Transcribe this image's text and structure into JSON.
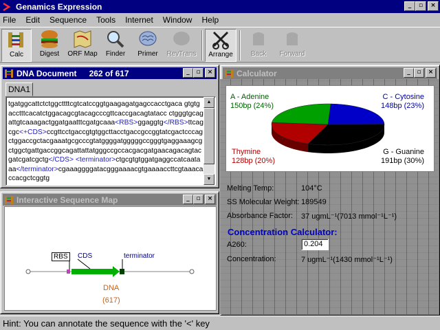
{
  "app": {
    "title": "Genamics Expression",
    "controls": {
      "minimize": "_",
      "maximize": "▫",
      "close": "×"
    }
  },
  "menu": [
    "File",
    "Edit",
    "Sequence",
    "Tools",
    "Internet",
    "Window",
    "Help"
  ],
  "toolbar": {
    "calc": "Calc",
    "digest": "Digest",
    "orf_map": "ORF Map",
    "finder": "Finder",
    "primer": "Primer",
    "revtrans": "RevTrans",
    "arrange": "Arrange",
    "back": "Back",
    "forward": "Forward"
  },
  "dna_window": {
    "title": "DNA Document",
    "position": "262 of 617",
    "tab": "DNA1",
    "sequence_segments": [
      {
        "text": "tgatggcattctctggcttttcgtcatccggtgaagagatgagccacctgaca gtgtgacctttcacatctggacagcgtacagcccgttcaccgacagtatacc ctgggtgcagattgtcaaagactggatgaatttcgatgcaaa",
        "tag": false
      },
      {
        "text": "<RBS>",
        "tag": true
      },
      {
        "text": "ggaggtg",
        "tag": false
      },
      {
        "text": "</RBS>",
        "tag": true
      },
      {
        "text": "ttcagcgc",
        "tag": false
      },
      {
        "text": "<+CDS>",
        "tag": true
      },
      {
        "text": "ccgttcctgaccgtgtggcttacctgaccgccggtatcgactcccagctggaccgctacgaaatgcgcccgtatggggatgggggccgggtgaggaaagcgctggctgattgaccggcagattattatgggccgccacgacgatgaacagacagtacgatcgatcgctg",
        "tag": false
      },
      {
        "text": "</CDS>",
        "tag": true
      },
      {
        "text": " ",
        "tag": false
      },
      {
        "text": "<terminator>",
        "tag": true
      },
      {
        "text": "ctgcgtgtggatgaggccatcaataaa",
        "tag": false
      },
      {
        "text": "</terminator>",
        "tag": true
      },
      {
        "text": "cgaaaggggatacgggaaaacgtgaaaaccttcgtaaacaccacgctcggtg",
        "tag": false
      }
    ]
  },
  "map_window": {
    "title": "Interactive Sequence Map",
    "features": {
      "rbs": "RBS",
      "cds": "CDS",
      "terminator": "terminator"
    },
    "name": "DNA",
    "length": "(617)"
  },
  "calc_window": {
    "title": "Calculator",
    "pie_labels": {
      "adenine": "A - Adenine",
      "adenine_val": "150bp (24%)",
      "cytosine": "C - Cytosine",
      "cytosine_val": "148bp (23%)",
      "thymine": "Thymine",
      "thymine_val": "128bp (20%)",
      "guanine": "G - Guanine",
      "guanine_val": "191bp (30%)"
    },
    "pie_colors": {
      "adenine": "#00a000",
      "cytosine": "#0000c8",
      "thymine": "#b00000",
      "guanine": "#000000"
    },
    "properties": [
      {
        "label": "Melting Temp:",
        "value": "104°C"
      },
      {
        "label": "SS Molecular Weight:",
        "value": "189549"
      },
      {
        "label": "Absorbance Factor:",
        "value": "37 ugmL⁻¹(7013 mmol⁻¹L⁻¹)"
      }
    ],
    "conc_title": "Concentration Calculator:",
    "a260_label": "A260:",
    "a260_value": "0.204",
    "conc_label": "Concentration:",
    "conc_value": "7  ugmL⁻¹(1430 mmol⁻¹L⁻¹)"
  },
  "chart_data": {
    "type": "pie",
    "categories": [
      "A - Adenine",
      "C - Cytosine",
      "G - Guanine",
      "Thymine"
    ],
    "values": [
      150,
      148,
      191,
      128
    ]
  },
  "hint": "Hint: You can annotate the sequence with the '<' key"
}
